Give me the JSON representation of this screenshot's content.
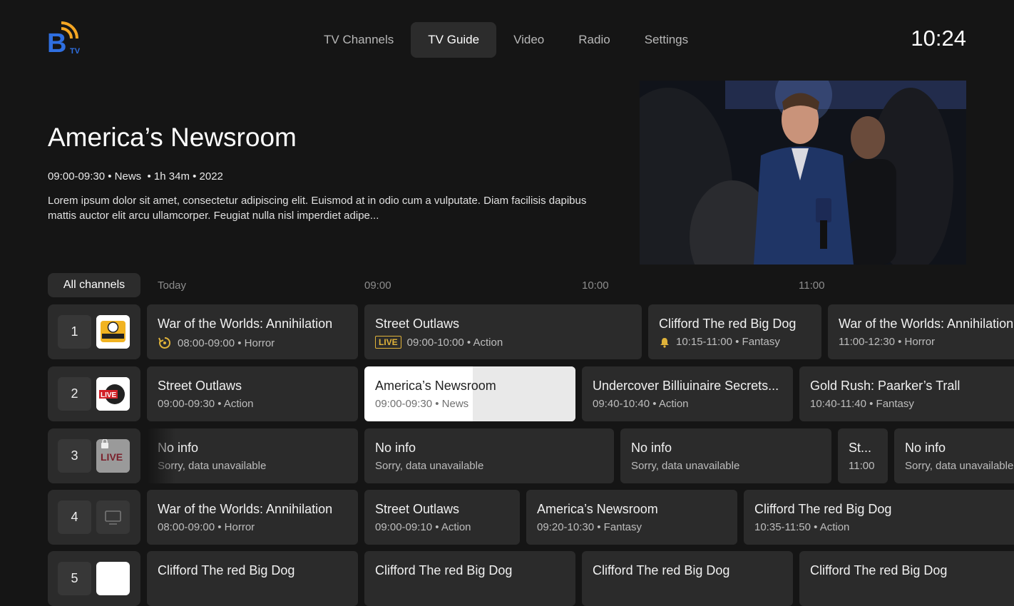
{
  "app": {
    "logo_letter": "B",
    "logo_sub": "TV",
    "clock": "10:24"
  },
  "nav": [
    {
      "label": "TV Channels",
      "active": false
    },
    {
      "label": "TV Guide",
      "active": true
    },
    {
      "label": "Video",
      "active": false
    },
    {
      "label": "Radio",
      "active": false
    },
    {
      "label": "Settings",
      "active": false
    }
  ],
  "featured": {
    "title": "America’s Newsroom",
    "meta": "09:00-09:30 • News  • 1h 34m • 2022",
    "description": "Lorem ipsum dolor sit amet, consectetur adipiscing elit. Euismod at in odio cum a vulputate. Diam facilisis dapibus mattis auctor elit arcu ullamcorper. Feugiat nulla nisl imperdiet adipe..."
  },
  "guide": {
    "filter_label": "All channels",
    "day_label": "Today",
    "times": [
      "09:00",
      "10:00",
      "11:00"
    ],
    "rows": [
      {
        "number": "1",
        "logo": "sports-news-logo",
        "programs": [
          {
            "title": "War of the Worlds: Annihilation",
            "sub": "08:00-09:00 •  Horror",
            "icon": "replay-icon"
          },
          {
            "title": "Street Outlaws",
            "sub": "09:00-10:00 • Action",
            "badge": "LIVE"
          },
          {
            "title": "Clifford The red Big Dog",
            "sub": "10:15-11:00 • Fantasy",
            "icon": "reminder-bell-icon"
          },
          {
            "title": "War of the Worlds: Annihilation",
            "sub": "11:00-12:30 •  Horror"
          }
        ]
      },
      {
        "number": "2",
        "logo": "live-news-hd-logo",
        "programs": [
          {
            "title": "Street Outlaws",
            "sub": "09:00-09:30 • Action"
          },
          {
            "title": "America’s Newsroom",
            "sub": "09:00-09:30 • News",
            "selected": true
          },
          {
            "title": "Undercover Billiuinaire Secrets...",
            "sub": "09:40-10:40 • Action"
          },
          {
            "title": "Gold Rush: Paarker’s Trall",
            "sub": "10:40-11:40 • Fantasy"
          }
        ]
      },
      {
        "number": "3",
        "logo": "locked-live-news-logo",
        "programs": [
          {
            "title": "No info",
            "sub": "Sorry, data unavailable"
          },
          {
            "title": "No info",
            "sub": "Sorry, data unavailable"
          },
          {
            "title": "No info",
            "sub": "Sorry, data unavailable"
          },
          {
            "title": "St...",
            "sub": "11:00"
          },
          {
            "title": "No info",
            "sub": "Sorry, data unavailable"
          }
        ]
      },
      {
        "number": "4",
        "logo": "tv-placeholder-icon",
        "programs": [
          {
            "title": "War of the Worlds: Annihilation",
            "sub": "08:00-09:00 •  Horror"
          },
          {
            "title": "Street Outlaws",
            "sub": "09:00-09:10 • Action"
          },
          {
            "title": "America’s Newsroom",
            "sub": "09:20-10:30 • Fantasy"
          },
          {
            "title": "Clifford The red Big Dog",
            "sub": "10:35-11:50 • Action"
          }
        ]
      },
      {
        "number": "5",
        "logo": "channel-logo",
        "programs": [
          {
            "title": "Clifford The red Big Dog",
            "sub": ""
          },
          {
            "title": "Clifford The red Big Dog",
            "sub": ""
          },
          {
            "title": "Clifford The red Big Dog",
            "sub": ""
          },
          {
            "title": "Clifford The red Big Dog",
            "sub": ""
          }
        ]
      }
    ]
  },
  "colors": {
    "background": "#151515",
    "cell": "#2b2b2b",
    "accent_live": "#e0b33a",
    "logo_blue": "#2f6fe0",
    "logo_orange": "#f5a623"
  }
}
